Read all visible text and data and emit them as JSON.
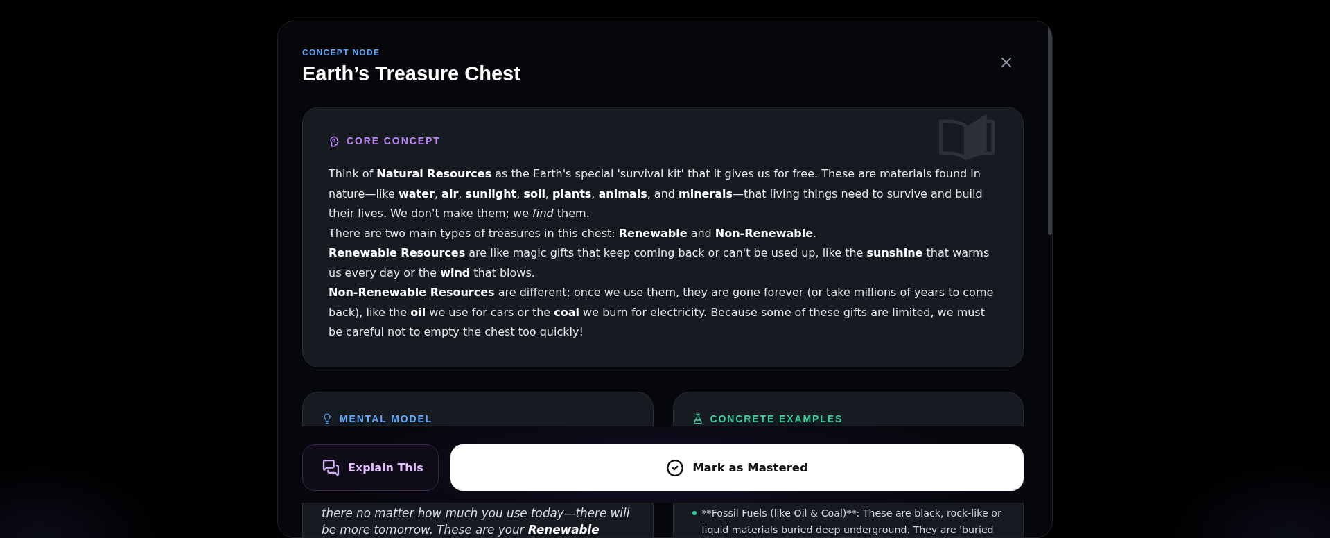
{
  "modal": {
    "eyebrow": "CONCEPT NODE",
    "title": "Earth’s Treasure Chest"
  },
  "core_concept": {
    "label": "CORE CONCEPT",
    "paragraphs": [
      "Think of **Natural Resources** as the Earth's special 'survival kit' that it gives us for free. These are materials found in nature—like **water**, **air**, **sunlight**, **soil**, **plants**, **animals**, and **minerals**—that living things need to survive and build their lives. We don't make them; we *find* them.",
      "There are two main types of treasures in this chest: **Renewable** and **Non-Renewable**.",
      "**Renewable Resources** are like magic gifts that keep coming back or can't be used up, like the **sunshine** that warms us every day or the **wind** that blows.",
      "**Non-Renewable Resources** are different; once we use them, they are gone forever (or take millions of years to come back), like the **oil** we use for cars or the **coal** we burn for electricity. Because some of these gifts are limited, we must be careful not to empty the chest too quickly!"
    ]
  },
  "sections": [
    {
      "kind": "mental_model",
      "label": "MENTAL MODEL",
      "text": "there no matter how much you use today—there will be more tomorrow. These are your **Renewable**"
    },
    {
      "kind": "examples",
      "label": "CONCRETE EXAMPLES",
      "items": [
        "**Fossil Fuels (like Oil & Coal)**: These are black, rock-like or liquid materials buried deep underground. They are 'buried"
      ]
    }
  ],
  "actions": [
    {
      "kind": "secondary",
      "label": "Explain This"
    },
    {
      "kind": "primary",
      "label": "Mark as Mastered"
    }
  ]
}
